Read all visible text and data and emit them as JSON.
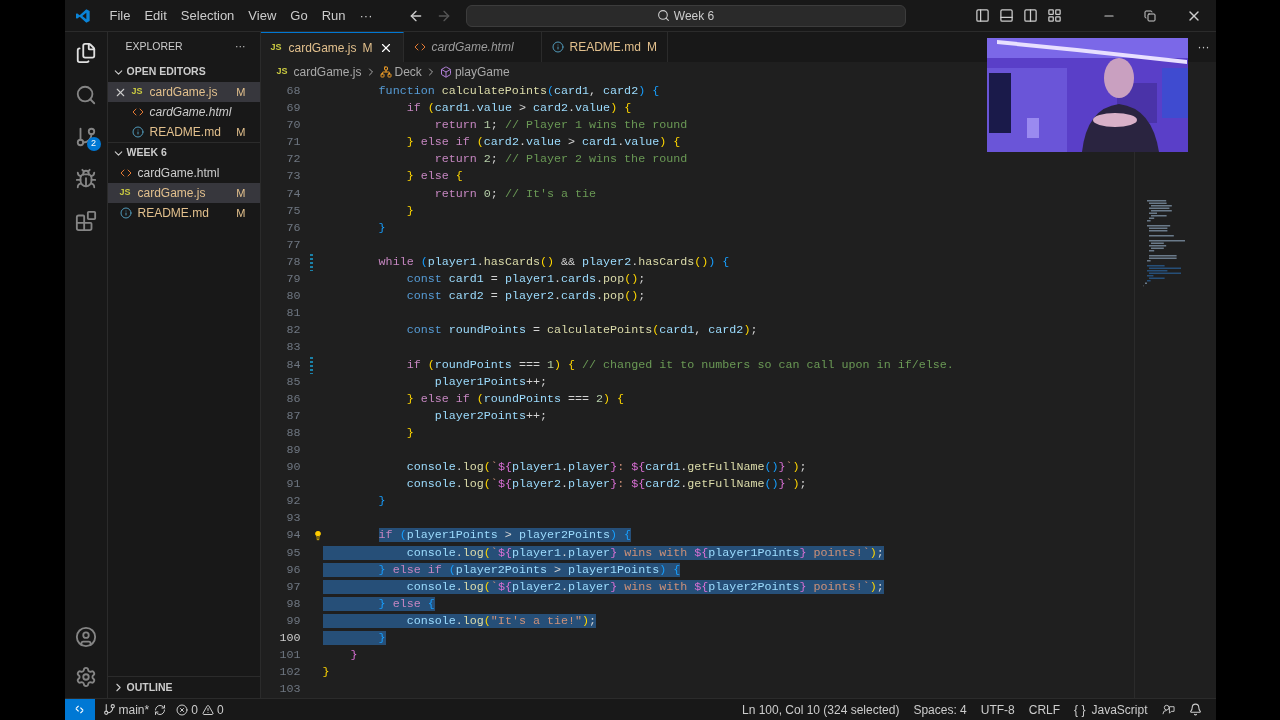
{
  "menu": [
    "File",
    "Edit",
    "Selection",
    "View",
    "Go",
    "Run",
    "···"
  ],
  "command_center": {
    "value": "Week 6"
  },
  "explorer": {
    "title": "EXPLORER",
    "more": "···",
    "sections": [
      {
        "title": "OPEN EDITORS",
        "expanded": true,
        "items": [
          {
            "name": "cardGame.js",
            "kind": "js",
            "icon_label": "JS",
            "badge": "M",
            "italic": false,
            "selected": true,
            "closable": true
          },
          {
            "name": "cardGame.html",
            "kind": "html",
            "italic": true,
            "selected": false,
            "closable": false
          },
          {
            "name": "README.md",
            "kind": "md",
            "badge": "M",
            "italic": false,
            "selected": false,
            "closable": false
          }
        ]
      },
      {
        "title": "WEEK 6",
        "expanded": true,
        "items": [
          {
            "name": "cardGame.html",
            "kind": "html",
            "italic": false,
            "selected": false,
            "closable": false
          },
          {
            "name": "cardGame.js",
            "kind": "js",
            "icon_label": "JS",
            "badge": "M",
            "italic": false,
            "selected": true,
            "closable": false
          },
          {
            "name": "README.md",
            "kind": "md",
            "badge": "M",
            "italic": false,
            "selected": false,
            "closable": false
          }
        ]
      }
    ],
    "outline": {
      "title": "OUTLINE",
      "expanded": false
    }
  },
  "activity_badge": "2",
  "tabs": [
    {
      "name": "cardGame.js",
      "kind": "js",
      "icon_label": "JS",
      "badge": "M",
      "italic": false,
      "selected": true
    },
    {
      "name": "cardGame.html",
      "kind": "html",
      "italic": true,
      "selected": false
    },
    {
      "name": "README.md",
      "kind": "md",
      "badge": "M",
      "italic": false,
      "selected": false
    }
  ],
  "tabs_more": "···",
  "breadcrumbs": [
    {
      "kind": "file",
      "icon_label": "JS",
      "text": "cardGame.js"
    },
    {
      "kind": "class",
      "text": "Deck"
    },
    {
      "kind": "method",
      "text": "playGame"
    }
  ],
  "lines": [
    {
      "n": "68",
      "selected": false,
      "active": false,
      "tokens": [
        {
          "kind": "st",
          "text": "        function "
        },
        {
          "kind": "fn",
          "text": "calculatePoints"
        },
        {
          "kind": "b3",
          "text": "("
        },
        {
          "kind": "v",
          "text": "card1"
        },
        {
          "kind": "p",
          "text": ", "
        },
        {
          "kind": "v",
          "text": "card2"
        },
        {
          "kind": "b3",
          "text": ") {"
        }
      ]
    },
    {
      "n": "69",
      "selected": false,
      "active": false,
      "tokens": [
        {
          "kind": "kw",
          "text": "            if "
        },
        {
          "kind": "b1",
          "text": "("
        },
        {
          "kind": "v",
          "text": "card1"
        },
        {
          "kind": "p",
          "text": "."
        },
        {
          "kind": "v",
          "text": "value"
        },
        {
          "kind": "p",
          "text": " > "
        },
        {
          "kind": "v",
          "text": "card2"
        },
        {
          "kind": "p",
          "text": "."
        },
        {
          "kind": "v",
          "text": "value"
        },
        {
          "kind": "b1",
          "text": ") {"
        }
      ]
    },
    {
      "n": "70",
      "selected": false,
      "active": false,
      "tokens": [
        {
          "kind": "kw",
          "text": "                return "
        },
        {
          "kind": "n",
          "text": "1"
        },
        {
          "kind": "p",
          "text": "; "
        },
        {
          "kind": "c",
          "text": "// Player 1 wins the round"
        }
      ]
    },
    {
      "n": "71",
      "selected": false,
      "active": false,
      "tokens": [
        {
          "kind": "b1",
          "text": "            } "
        },
        {
          "kind": "kw",
          "text": "else if "
        },
        {
          "kind": "b1",
          "text": "("
        },
        {
          "kind": "v",
          "text": "card2"
        },
        {
          "kind": "p",
          "text": "."
        },
        {
          "kind": "v",
          "text": "value"
        },
        {
          "kind": "p",
          "text": " > "
        },
        {
          "kind": "v",
          "text": "card1"
        },
        {
          "kind": "p",
          "text": "."
        },
        {
          "kind": "v",
          "text": "value"
        },
        {
          "kind": "b1",
          "text": ") {"
        }
      ]
    },
    {
      "n": "72",
      "selected": false,
      "active": false,
      "tokens": [
        {
          "kind": "kw",
          "text": "                return "
        },
        {
          "kind": "n",
          "text": "2"
        },
        {
          "kind": "p",
          "text": "; "
        },
        {
          "kind": "c",
          "text": "// Player 2 wins the round"
        }
      ]
    },
    {
      "n": "73",
      "selected": false,
      "active": false,
      "tokens": [
        {
          "kind": "b1",
          "text": "            } "
        },
        {
          "kind": "kw",
          "text": "else "
        },
        {
          "kind": "b1",
          "text": "{"
        }
      ]
    },
    {
      "n": "74",
      "selected": false,
      "active": false,
      "tokens": [
        {
          "kind": "kw",
          "text": "                return "
        },
        {
          "kind": "n",
          "text": "0"
        },
        {
          "kind": "p",
          "text": "; "
        },
        {
          "kind": "c",
          "text": "// It's a tie"
        }
      ]
    },
    {
      "n": "75",
      "selected": false,
      "active": false,
      "tokens": [
        {
          "kind": "b1",
          "text": "            }"
        }
      ]
    },
    {
      "n": "76",
      "selected": false,
      "active": false,
      "tokens": [
        {
          "kind": "b3",
          "text": "        }"
        }
      ]
    },
    {
      "n": "77",
      "active": false
    },
    {
      "n": "78",
      "selected": false,
      "active": false,
      "gutter": {
        "kind": "modified"
      },
      "tokens": [
        {
          "kind": "kw",
          "text": "        while "
        },
        {
          "kind": "b3",
          "text": "("
        },
        {
          "kind": "v",
          "text": "player1"
        },
        {
          "kind": "p",
          "text": "."
        },
        {
          "kind": "fn",
          "text": "hasCards"
        },
        {
          "kind": "b1",
          "text": "()"
        },
        {
          "kind": "p",
          "text": " && "
        },
        {
          "kind": "v",
          "text": "player2"
        },
        {
          "kind": "p",
          "text": "."
        },
        {
          "kind": "fn",
          "text": "hasCards"
        },
        {
          "kind": "b1",
          "text": "()"
        },
        {
          "kind": "b3",
          "text": ") {"
        }
      ]
    },
    {
      "n": "79",
      "selected": false,
      "active": false,
      "tokens": [
        {
          "kind": "st",
          "text": "            const "
        },
        {
          "kind": "v",
          "text": "card1"
        },
        {
          "kind": "p",
          "text": " = "
        },
        {
          "kind": "v",
          "text": "player1"
        },
        {
          "kind": "p",
          "text": "."
        },
        {
          "kind": "v",
          "text": "cards"
        },
        {
          "kind": "p",
          "text": "."
        },
        {
          "kind": "fn",
          "text": "pop"
        },
        {
          "kind": "b1",
          "text": "()"
        },
        {
          "kind": "p",
          "text": ";"
        }
      ]
    },
    {
      "n": "80",
      "selected": false,
      "active": false,
      "tokens": [
        {
          "kind": "st",
          "text": "            const "
        },
        {
          "kind": "v",
          "text": "card2"
        },
        {
          "kind": "p",
          "text": " = "
        },
        {
          "kind": "v",
          "text": "player2"
        },
        {
          "kind": "p",
          "text": "."
        },
        {
          "kind": "v",
          "text": "cards"
        },
        {
          "kind": "p",
          "text": "."
        },
        {
          "kind": "fn",
          "text": "pop"
        },
        {
          "kind": "b1",
          "text": "()"
        },
        {
          "kind": "p",
          "text": ";"
        }
      ]
    },
    {
      "n": "81",
      "active": false
    },
    {
      "n": "82",
      "selected": false,
      "active": false,
      "tokens": [
        {
          "kind": "st",
          "text": "            const "
        },
        {
          "kind": "v",
          "text": "roundPoints"
        },
        {
          "kind": "p",
          "text": " = "
        },
        {
          "kind": "fn",
          "text": "calculatePoints"
        },
        {
          "kind": "b1",
          "text": "("
        },
        {
          "kind": "v",
          "text": "card1"
        },
        {
          "kind": "p",
          "text": ", "
        },
        {
          "kind": "v",
          "text": "card2"
        },
        {
          "kind": "b1",
          "text": ")"
        },
        {
          "kind": "p",
          "text": ";"
        }
      ]
    },
    {
      "n": "83",
      "active": false
    },
    {
      "n": "84",
      "selected": false,
      "active": false,
      "gutter": {
        "kind": "modified"
      },
      "tokens": [
        {
          "kind": "kw",
          "text": "            if "
        },
        {
          "kind": "b1",
          "text": "("
        },
        {
          "kind": "v",
          "text": "roundPoints"
        },
        {
          "kind": "p",
          "text": " === "
        },
        {
          "kind": "n",
          "text": "1"
        },
        {
          "kind": "b1",
          "text": ") { "
        },
        {
          "kind": "c",
          "text": "// changed it to numbers so can call upon in if/else."
        }
      ]
    },
    {
      "n": "85",
      "selected": false,
      "active": false,
      "tokens": [
        {
          "kind": "v",
          "text": "                player1Points"
        },
        {
          "kind": "p",
          "text": "++;"
        }
      ]
    },
    {
      "n": "86",
      "selected": false,
      "active": false,
      "tokens": [
        {
          "kind": "b1",
          "text": "            } "
        },
        {
          "kind": "kw",
          "text": "else if "
        },
        {
          "kind": "b1",
          "text": "("
        },
        {
          "kind": "v",
          "text": "roundPoints"
        },
        {
          "kind": "p",
          "text": " === "
        },
        {
          "kind": "n",
          "text": "2"
        },
        {
          "kind": "b1",
          "text": ") {"
        }
      ]
    },
    {
      "n": "87",
      "selected": false,
      "active": false,
      "tokens": [
        {
          "kind": "v",
          "text": "                player2Points"
        },
        {
          "kind": "p",
          "text": "++;"
        }
      ]
    },
    {
      "n": "88",
      "selected": false,
      "active": false,
      "tokens": [
        {
          "kind": "b1",
          "text": "            }"
        }
      ]
    },
    {
      "n": "89",
      "active": false
    },
    {
      "n": "90",
      "selected": false,
      "active": false,
      "tokens": [
        {
          "kind": "v",
          "text": "            console"
        },
        {
          "kind": "p",
          "text": "."
        },
        {
          "kind": "fn",
          "text": "log"
        },
        {
          "kind": "b1",
          "text": "("
        },
        {
          "kind": "s",
          "text": "`"
        },
        {
          "kind": "b2",
          "text": "${"
        },
        {
          "kind": "v",
          "text": "player1"
        },
        {
          "kind": "p",
          "text": "."
        },
        {
          "kind": "v",
          "text": "player"
        },
        {
          "kind": "b2",
          "text": "}"
        },
        {
          "kind": "s",
          "text": ": "
        },
        {
          "kind": "b2",
          "text": "${"
        },
        {
          "kind": "v",
          "text": "card1"
        },
        {
          "kind": "p",
          "text": "."
        },
        {
          "kind": "fn",
          "text": "getFullName"
        },
        {
          "kind": "b3",
          "text": "()"
        },
        {
          "kind": "b2",
          "text": "}"
        },
        {
          "kind": "s",
          "text": "`"
        },
        {
          "kind": "b1",
          "text": ")"
        },
        {
          "kind": "p",
          "text": ";"
        }
      ]
    },
    {
      "n": "91",
      "selected": false,
      "active": false,
      "tokens": [
        {
          "kind": "v",
          "text": "            console"
        },
        {
          "kind": "p",
          "text": "."
        },
        {
          "kind": "fn",
          "text": "log"
        },
        {
          "kind": "b1",
          "text": "("
        },
        {
          "kind": "s",
          "text": "`"
        },
        {
          "kind": "b2",
          "text": "${"
        },
        {
          "kind": "v",
          "text": "player2"
        },
        {
          "kind": "p",
          "text": "."
        },
        {
          "kind": "v",
          "text": "player"
        },
        {
          "kind": "b2",
          "text": "}"
        },
        {
          "kind": "s",
          "text": ": "
        },
        {
          "kind": "b2",
          "text": "${"
        },
        {
          "kind": "v",
          "text": "card2"
        },
        {
          "kind": "p",
          "text": "."
        },
        {
          "kind": "fn",
          "text": "getFullName"
        },
        {
          "kind": "b3",
          "text": "()"
        },
        {
          "kind": "b2",
          "text": "}"
        },
        {
          "kind": "s",
          "text": "`"
        },
        {
          "kind": "b1",
          "text": ")"
        },
        {
          "kind": "p",
          "text": ";"
        }
      ]
    },
    {
      "n": "92",
      "selected": false,
      "active": false,
      "tokens": [
        {
          "kind": "b3",
          "text": "        }"
        }
      ]
    },
    {
      "n": "93",
      "active": false
    },
    {
      "n": "94",
      "selected": true,
      "active": false,
      "gutter": {
        "kind": "lightbulb"
      },
      "tokens": [
        {
          "kind": "kw",
          "text": "        if "
        },
        {
          "kind": "b3",
          "text": "("
        },
        {
          "kind": "v",
          "text": "player1Points"
        },
        {
          "kind": "p",
          "text": " > "
        },
        {
          "kind": "v",
          "text": "player2Points"
        },
        {
          "kind": "b3",
          "text": ") {"
        }
      ]
    },
    {
      "n": "95",
      "selected": true,
      "active": false,
      "tokens": [
        {
          "kind": "v",
          "text": "            console"
        },
        {
          "kind": "p",
          "text": "."
        },
        {
          "kind": "fn",
          "text": "log"
        },
        {
          "kind": "b1",
          "text": "("
        },
        {
          "kind": "s",
          "text": "`"
        },
        {
          "kind": "b2",
          "text": "${"
        },
        {
          "kind": "v",
          "text": "player1"
        },
        {
          "kind": "p",
          "text": "."
        },
        {
          "kind": "v",
          "text": "player"
        },
        {
          "kind": "b2",
          "text": "}"
        },
        {
          "kind": "s",
          "text": " wins with "
        },
        {
          "kind": "b2",
          "text": "${"
        },
        {
          "kind": "v",
          "text": "player1Points"
        },
        {
          "kind": "b2",
          "text": "}"
        },
        {
          "kind": "s",
          "text": " points!`"
        },
        {
          "kind": "b1",
          "text": ")"
        },
        {
          "kind": "p",
          "text": ";"
        }
      ]
    },
    {
      "n": "96",
      "selected": true,
      "active": false,
      "tokens": [
        {
          "kind": "b3",
          "text": "        } "
        },
        {
          "kind": "kw",
          "text": "else if "
        },
        {
          "kind": "b3",
          "text": "("
        },
        {
          "kind": "v",
          "text": "player2Points"
        },
        {
          "kind": "p",
          "text": " > "
        },
        {
          "kind": "v",
          "text": "player1Points"
        },
        {
          "kind": "b3",
          "text": ") {"
        }
      ]
    },
    {
      "n": "97",
      "selected": true,
      "active": false,
      "tokens": [
        {
          "kind": "v",
          "text": "            console"
        },
        {
          "kind": "p",
          "text": "."
        },
        {
          "kind": "fn",
          "text": "log"
        },
        {
          "kind": "b1",
          "text": "("
        },
        {
          "kind": "s",
          "text": "`"
        },
        {
          "kind": "b2",
          "text": "${"
        },
        {
          "kind": "v",
          "text": "player2"
        },
        {
          "kind": "p",
          "text": "."
        },
        {
          "kind": "v",
          "text": "player"
        },
        {
          "kind": "b2",
          "text": "}"
        },
        {
          "kind": "s",
          "text": " wins with "
        },
        {
          "kind": "b2",
          "text": "${"
        },
        {
          "kind": "v",
          "text": "player2Points"
        },
        {
          "kind": "b2",
          "text": "}"
        },
        {
          "kind": "s",
          "text": " points!`"
        },
        {
          "kind": "b1",
          "text": ")"
        },
        {
          "kind": "p",
          "text": ";"
        }
      ]
    },
    {
      "n": "98",
      "selected": true,
      "active": false,
      "tokens": [
        {
          "kind": "b3",
          "text": "        } "
        },
        {
          "kind": "kw",
          "text": "else "
        },
        {
          "kind": "b3",
          "text": "{"
        }
      ]
    },
    {
      "n": "99",
      "selected": true,
      "active": false,
      "tokens": [
        {
          "kind": "v",
          "text": "            console"
        },
        {
          "kind": "p",
          "text": "."
        },
        {
          "kind": "fn",
          "text": "log"
        },
        {
          "kind": "b1",
          "text": "("
        },
        {
          "kind": "s",
          "text": "\"It's a tie!\""
        },
        {
          "kind": "b1",
          "text": ")"
        },
        {
          "kind": "p",
          "text": ";"
        }
      ]
    },
    {
      "n": "100",
      "selected": true,
      "active": true,
      "tokens": [
        {
          "kind": "b3",
          "text": "        }"
        }
      ]
    },
    {
      "n": "101",
      "selected": false,
      "active": false,
      "tokens": [
        {
          "kind": "b2",
          "text": "    }"
        }
      ]
    },
    {
      "n": "102",
      "selected": false,
      "active": false,
      "tokens": [
        {
          "kind": "b1",
          "text": "}"
        }
      ]
    },
    {
      "n": "103",
      "active": false
    }
  ],
  "status_bar": {
    "branch": "main*",
    "errors": "0",
    "warnings": "0",
    "position": "Ln 100, Col 10 (324 selected)",
    "indent": "Spaces: 4",
    "encoding": "UTF-8",
    "eol": "CRLF",
    "language_icon": "{ }",
    "language": "JavaScript"
  }
}
